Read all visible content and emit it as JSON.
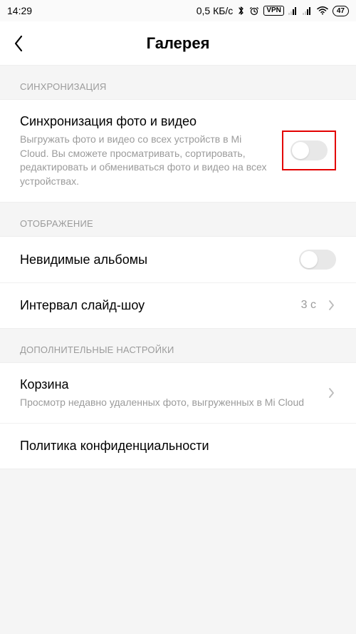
{
  "statusbar": {
    "time": "14:29",
    "data_rate": "0,5 КБ/с",
    "vpn_label": "VPN",
    "battery": "47"
  },
  "header": {
    "title": "Галерея"
  },
  "sections": {
    "sync": {
      "header": "СИНХРОНИЗАЦИЯ",
      "item": {
        "title": "Синхронизация фото и видео",
        "desc": "Выгружать фото и видео со всех устройств в Mi Cloud. Вы сможете просматривать, сортировать, редактировать и обмениваться фото и видео на всех устройствах."
      }
    },
    "display": {
      "header": "ОТОБРАЖЕНИЕ",
      "hidden_albums": {
        "title": "Невидимые альбомы"
      },
      "slideshow": {
        "title": "Интервал слайд-шоу",
        "value": "3 с"
      }
    },
    "advanced": {
      "header": "ДОПОЛНИТЕЛЬНЫЕ НАСТРОЙКИ",
      "trash": {
        "title": "Корзина",
        "desc": "Просмотр недавно удаленных фото, выгруженных в Mi Cloud"
      },
      "privacy": {
        "title": "Политика конфиденциальности"
      }
    }
  }
}
